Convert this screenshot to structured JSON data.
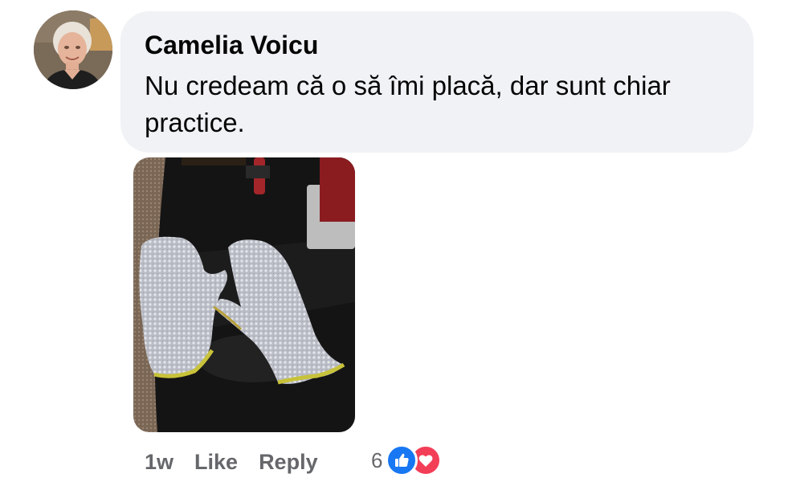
{
  "comment": {
    "author": "Camelia Voicu",
    "text": "Nu credeam că o să îmi placă, dar sunt chiar practice.",
    "photo_icon": "photo-of-mesh-gloves",
    "avatar_icon": "profile-photo"
  },
  "actions": {
    "timestamp": "1w",
    "like_label": "Like",
    "reply_label": "Reply"
  },
  "reactions": {
    "count": "6",
    "types": [
      "like-icon",
      "love-icon"
    ],
    "colors": {
      "like": "#1877f2",
      "love": "#f33e58"
    }
  },
  "theme": {
    "bubble_bg": "#f0f2f5",
    "text_color": "#050505",
    "secondary_text": "#65676b"
  }
}
